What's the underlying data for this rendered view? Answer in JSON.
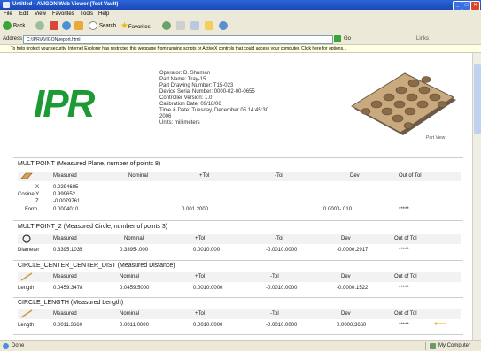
{
  "window": {
    "title": "Untitled - AVIGON Web Viewer (Test Vault)",
    "controls": [
      "_",
      "□",
      "×"
    ]
  },
  "menu": [
    "File",
    "Edit",
    "View",
    "Favorites",
    "Tools",
    "Help"
  ],
  "toolbar": {
    "back_label": "Back",
    "search_label": "Search",
    "favorites_label": "Favorites",
    "links_label": "Links"
  },
  "address": {
    "label": "Address",
    "value": "C:\\IPR\\AVIGON\\report.html",
    "go_label": "Go"
  },
  "infobar": "To help protect your security, Internet Explorer has restricted this webpage from running scripts or ActiveX controls that could access your computer. Click here for options...",
  "header": {
    "logo_text": "IPR",
    "info_lines": [
      "Operator: D. Shuman",
      "Part Name: Tray-15",
      "Part Drawing Number: T15-023",
      "Device Serial Number: 0000-02-00-0655",
      "Controller Version: 1.0",
      "Calibration Date: 09/18/06",
      "Time & Date: Tuesday, December 05 14:45:30",
      "2006",
      "Units: millimeters"
    ],
    "image_caption": "Part View"
  },
  "sections": [
    {
      "title": "MULTIPOINT (Measured Plane, number of points 8)",
      "icon": "plane-icon",
      "columns": [
        "Measured",
        "Nominal",
        "+Tol",
        "-Tol",
        "Dev",
        "Out of Tol"
      ],
      "rows": [
        {
          "label": "X",
          "measured": "0.0294685",
          "nominal": "",
          "plus": "",
          "minus": "",
          "dev": "",
          "oot": ""
        },
        {
          "label": "Cosine Y",
          "measured": "0.999652",
          "nominal": "",
          "plus": "",
          "minus": "",
          "dev": "",
          "oot": ""
        },
        {
          "label": "Z",
          "measured": "-0.0079761",
          "nominal": "",
          "plus": "",
          "minus": "",
          "dev": "",
          "oot": ""
        },
        {
          "label": "Form",
          "measured": "0.0004010",
          "nominal": "",
          "plus": "0.001.2000",
          "minus": "",
          "dev": "0.0000-.010",
          "oot": "*****"
        }
      ]
    },
    {
      "title": "MULTIPOINT_2 (Measured Circle, number of points 3)",
      "icon": "circle-icon",
      "columns": [
        "Measured",
        "Nominal",
        "+Tol",
        "-Tol",
        "Dev",
        "Out of Tol"
      ],
      "rows": [
        {
          "label": "Diameter",
          "measured": "0.3395.1035",
          "nominal": "0.3395-.000",
          "plus": "0.0010.000",
          "minus": "-0.0010.0000",
          "dev": "-0.0000.2917",
          "oot": "*****"
        }
      ]
    },
    {
      "title": "CIRCLE_CENTER_CENTER_DIST (Measured Distance)",
      "icon": "caliper-icon",
      "columns": [
        "Measured",
        "Nominal",
        "+Tol",
        "-Tol",
        "Dev",
        "Out of Tol"
      ],
      "rows": [
        {
          "label": "Length",
          "measured": "0.0459.3478",
          "nominal": "0.0459.5000",
          "plus": "0.0010.0000",
          "minus": "-0.0010.0000",
          "dev": "-0.0000.1522",
          "oot": "*****"
        }
      ]
    },
    {
      "title": "CIRCLE_LENGTH (Measured Length)",
      "icon": "caliper-icon",
      "columns": [
        "Measured",
        "Nominal",
        "+Tol",
        "-Tol",
        "Dev",
        "Out of Tol"
      ],
      "rows": [
        {
          "label": "Length",
          "measured": "0.0011.3660",
          "nominal": "0.0011.0000",
          "plus": "0.0010.0000",
          "minus": "-0.0010.0000",
          "dev": "0.0000.3660",
          "oot": "*****"
        }
      ]
    }
  ],
  "status": {
    "left": "Done",
    "right": "My Computer"
  },
  "colors": {
    "logo": "#1d9a34",
    "titlebar": "#2a64d8",
    "arrow": "#f0a000"
  }
}
